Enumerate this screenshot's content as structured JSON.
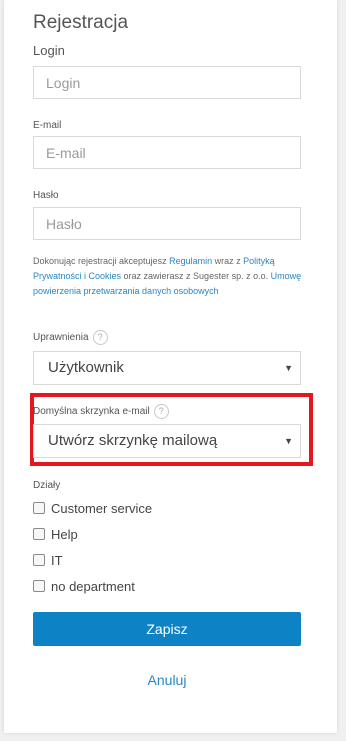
{
  "form": {
    "title": "Rejestracja",
    "login_label": "Login",
    "login_placeholder": "Login",
    "email_label": "E-mail",
    "email_placeholder": "E-mail",
    "password_label": "Hasło",
    "password_placeholder": "Hasło",
    "consent": {
      "part1": "Dokonując rejestracji akceptujesz ",
      "link_terms": "Regulamin",
      "part2": " wraz z ",
      "link_privacy": "Polityką Prywatności i Cookies",
      "part3": " oraz zawierasz z Sugester sp. z o.o. ",
      "link_dpa": "Umowę powierzenia przetwarzania danych osobowych"
    },
    "permissions_label": "Uprawnienia",
    "permissions_value": "Użytkownik",
    "mailbox_label": "Domyślna skrzynka e-mail",
    "mailbox_value": "Utwórz skrzynkę mailową",
    "departments_label": "Działy",
    "departments": [
      "Customer service",
      "Help",
      "IT",
      "no department"
    ],
    "submit_label": "Zapisz",
    "cancel_label": "Anuluj",
    "help_symbol": "?",
    "caret_symbol": "▼"
  },
  "colors": {
    "accent": "#0d83c6",
    "link": "#2a86c7",
    "highlight": "#e4171f"
  }
}
